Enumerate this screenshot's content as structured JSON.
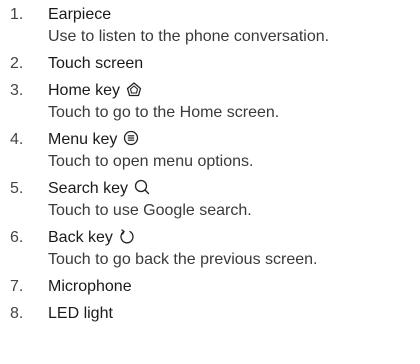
{
  "items": [
    {
      "num": "1.",
      "title": "Earpiece",
      "desc": "Use to listen to the phone conversation.",
      "icon": ""
    },
    {
      "num": "2.",
      "title": "Touch screen",
      "desc": "",
      "icon": ""
    },
    {
      "num": "3.",
      "title": "Home key",
      "desc": "Touch to go to the Home screen.",
      "icon": "home-icon"
    },
    {
      "num": "4.",
      "title": "Menu key",
      "desc": "Touch to open menu options.",
      "icon": "menu-icon"
    },
    {
      "num": "5.",
      "title": "Search key",
      "desc": "Touch to use Google search.",
      "icon": "search-icon"
    },
    {
      "num": "6.",
      "title": "Back key",
      "desc": "Touch to go back the previous screen.",
      "icon": "back-icon"
    },
    {
      "num": "7.",
      "title": "Microphone",
      "desc": "",
      "icon": ""
    },
    {
      "num": "8.",
      "title": "LED light",
      "desc": "",
      "icon": ""
    }
  ]
}
